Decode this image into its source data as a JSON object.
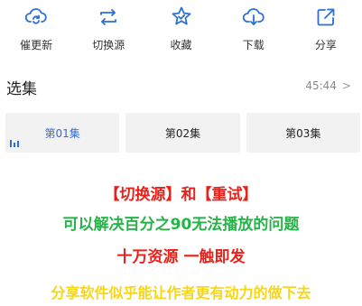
{
  "toolbar": {
    "items": [
      {
        "label": "催更新",
        "icon": "cloud-refresh-icon"
      },
      {
        "label": "切换源",
        "icon": "switch-arrows-icon"
      },
      {
        "label": "收藏",
        "icon": "star-badge-icon"
      },
      {
        "label": "下载",
        "icon": "cloud-download-icon"
      },
      {
        "label": "分享",
        "icon": "share-icon"
      }
    ]
  },
  "episodes": {
    "title": "选集",
    "duration": "45:44",
    "items": [
      {
        "label": "第01集",
        "active": true
      },
      {
        "label": "第02集",
        "active": false
      },
      {
        "label": "第03集",
        "active": false
      }
    ]
  },
  "promo": {
    "line1": "【切换源】和【重试】",
    "line2": "可以解决百分之90无法播放的问题",
    "line3": "十万资源  一触即发",
    "line4": "分享软件似乎能让作者更有动力的做下去"
  },
  "colors": {
    "accent": "#2d6fd6",
    "red": "#e8221b",
    "green": "#27b34a",
    "yellow": "#f6d615"
  }
}
